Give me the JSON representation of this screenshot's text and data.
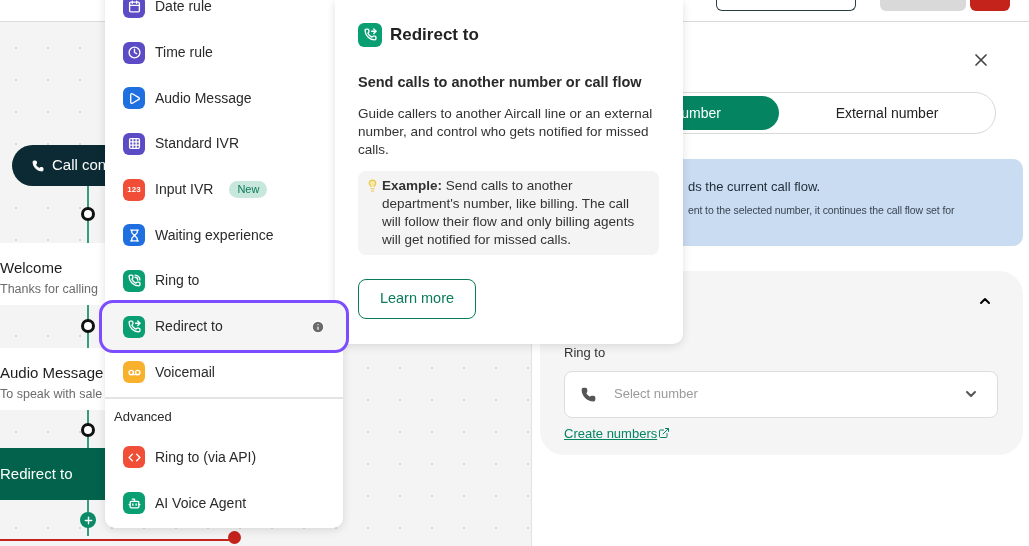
{
  "canvas": {
    "nodes": [
      {
        "kind": "start",
        "title": "Call con"
      },
      {
        "kind": "card",
        "title": "Welcome",
        "subtitle": "Thanks for calling"
      },
      {
        "kind": "card",
        "title": "Audio Message",
        "subtitle": "To speak with sale"
      },
      {
        "kind": "action",
        "title": "Redirect to"
      }
    ]
  },
  "menu": {
    "items": [
      {
        "label": "Date rule",
        "color": "#5b4bc4",
        "selected": false
      },
      {
        "label": "Time rule",
        "color": "#5b4bc4",
        "selected": false
      },
      {
        "label": "Audio Message",
        "color": "#1f6fe0",
        "selected": false
      },
      {
        "label": "Standard IVR",
        "color": "#5b4bc4",
        "selected": false
      },
      {
        "label": "Input IVR",
        "color": "#f04e37",
        "selected": false,
        "icon_text": "123",
        "badge": "New"
      },
      {
        "label": "Waiting experience",
        "color": "#1f6fe0",
        "selected": false
      },
      {
        "label": "Ring to",
        "color": "#0a9f72",
        "selected": false
      },
      {
        "label": "Redirect to",
        "color": "#0a9f72",
        "selected": true
      },
      {
        "label": "Voicemail",
        "color": "#f8b12c",
        "selected": false
      }
    ],
    "section": "Advanced",
    "advanced_items": [
      {
        "label": "Ring to (via API)",
        "color": "#f04e37",
        "selected": false
      },
      {
        "label": "AI Voice Agent",
        "color": "#0a9f72",
        "selected": false
      }
    ]
  },
  "popover": {
    "title": "Redirect to",
    "heading": "Send calls to another number or call flow",
    "description": "Guide callers to another Aircall line or an external number, and control who gets notified for missed calls.",
    "example": "**Example:** Send calls to another department's number, like billing. The call will follow their flow and only billing agents will get notified for missed calls.",
    "button": "Learn more"
  },
  "panel": {
    "segments": [
      {
        "label": "umber",
        "selected": true
      },
      {
        "label": "External number",
        "selected": false
      }
    ],
    "info": {
      "title": "ds the current call flow.",
      "text": "ent to the selected number, it continues the call flow set for"
    },
    "section": {
      "expanded": true,
      "field_label": "Ring to",
      "select": {
        "placeholder": "Select number"
      },
      "link": "Create numbers"
    }
  }
}
